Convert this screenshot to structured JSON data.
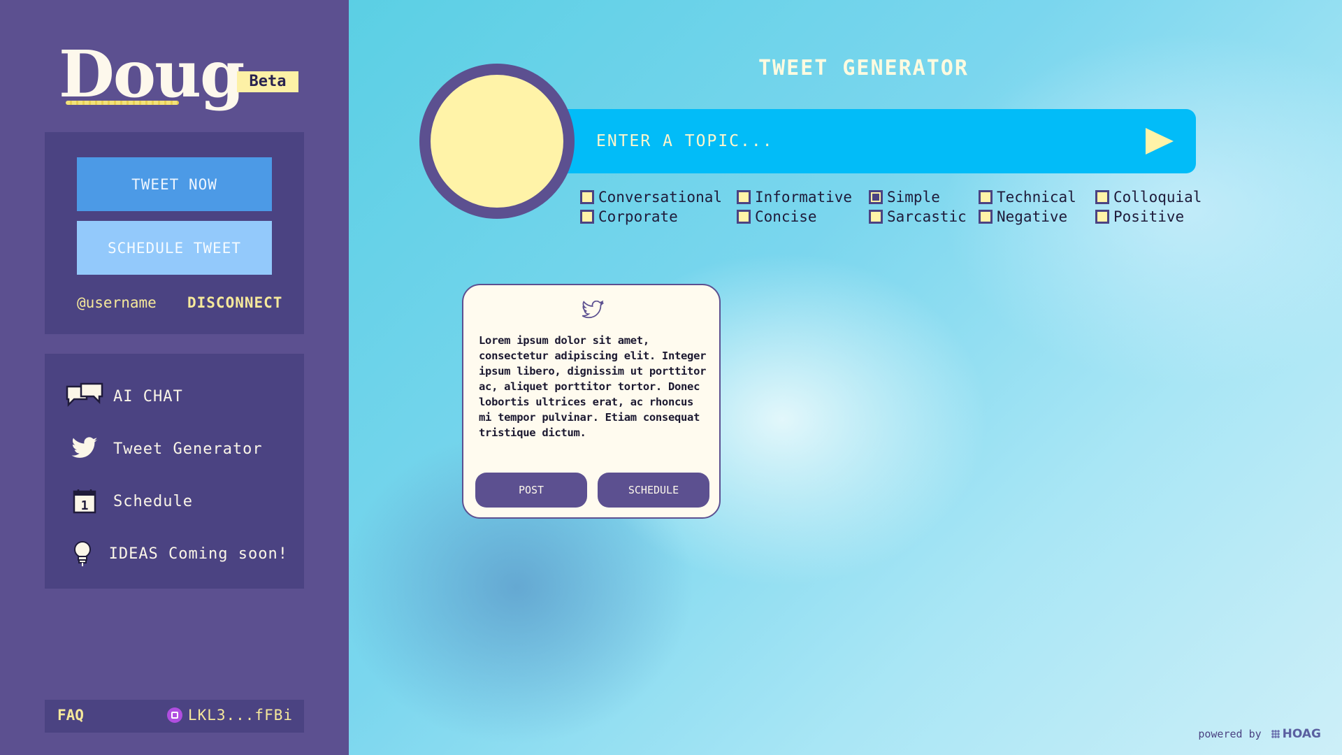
{
  "app": {
    "logo": "Doug",
    "badge": "Beta"
  },
  "sidebar": {
    "account": {
      "tweet_now": "TWEET NOW",
      "schedule_tweet": "SCHEDULE TWEET",
      "username": "@username",
      "disconnect": "DISCONNECT"
    },
    "nav": [
      {
        "label": "AI CHAT",
        "icon": "chat-bubbles-icon"
      },
      {
        "label": "Tweet Generator",
        "icon": "twitter-bird-icon"
      },
      {
        "label": "Schedule",
        "icon": "calendar-icon"
      },
      {
        "label": "IDEAS Coming soon!",
        "icon": "lightbulb-icon"
      }
    ],
    "footer": {
      "faq": "FAQ",
      "wallet": "LKL3...fFBi"
    }
  },
  "main": {
    "title": "TWEET GENERATOR",
    "topic_placeholder": "ENTER A TOPIC...",
    "tones": [
      {
        "label": "Conversational",
        "checked": false
      },
      {
        "label": "Informative",
        "checked": false
      },
      {
        "label": "Simple",
        "checked": true
      },
      {
        "label": "Technical",
        "checked": false
      },
      {
        "label": "Colloquial",
        "checked": false
      },
      {
        "label": "Corporate",
        "checked": false
      },
      {
        "label": "Concise",
        "checked": false
      },
      {
        "label": "Sarcastic",
        "checked": false
      },
      {
        "label": "Negative",
        "checked": false
      },
      {
        "label": "Positive",
        "checked": false
      }
    ],
    "card": {
      "text": "Lorem ipsum dolor sit amet, consectetur adipiscing elit. Integer ipsum libero, dignissim ut porttitor ac, aliquet porttitor tortor. Donec lobortis ultrices erat, ac rhoncus mi tempor pulvinar. Etiam consequat tristique dictum.",
      "post": "POST",
      "schedule": "SCHEDULE"
    },
    "powered_by": "powered by",
    "brand": "HOAG"
  },
  "colors": {
    "sidebar_bg": "#5c5090",
    "panel_bg": "#4b4382",
    "accent_yellow": "#fff3a8",
    "topic_bar": "#02bcf8",
    "tweet_now_bg": "#4c9ae6",
    "schedule_bg": "#93c9fb"
  }
}
